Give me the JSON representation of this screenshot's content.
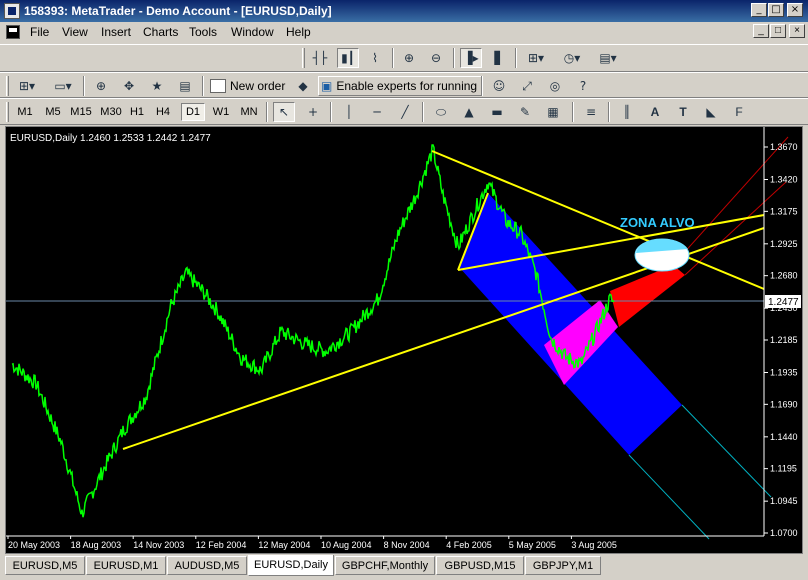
{
  "window": {
    "title": "158393: MetaTrader - Demo Account - [EURUSD,Daily]"
  },
  "window_buttons": {
    "minimize": "_",
    "maximize": "□",
    "close": "×"
  },
  "menu": [
    "File",
    "View",
    "Insert",
    "Charts",
    "Tools",
    "Window",
    "Help"
  ],
  "toolbar2": {
    "new_order": "New order",
    "experts": "Enable experts for running"
  },
  "timeframes": [
    "M1",
    "M5",
    "M15",
    "M30",
    "H1",
    "H4",
    "D1",
    "W1",
    "MN"
  ],
  "active_timeframe": "D1",
  "tools_text": {
    "text": "A",
    "label": "T",
    "fibo": "F"
  },
  "chart": {
    "info": "EURUSD,Daily  1.2460 1.2533 1.2442 1.2477",
    "current_price": "1.2477",
    "price_labels": [
      "1.3670",
      "1.3420",
      "1.3175",
      "1.2925",
      "1.2680",
      "1.2430",
      "1.2185",
      "1.1935",
      "1.1690",
      "1.1440",
      "1.1195",
      "1.0945",
      "1.0700"
    ],
    "date_labels": [
      "20 May 2003",
      "18 Aug 2003",
      "14 Nov 2003",
      "12 Feb 2004",
      "12 May 2004",
      "10 Aug 2004",
      "8 Nov 2004",
      "4 Feb 2005",
      "5 May 2005",
      "3 Aug 2005"
    ],
    "annotation": "ZONA ALVO",
    "colors": {
      "background": "#000000",
      "price_line": "#00ff00",
      "trendline": "#ffff00",
      "channel": "#0000ff",
      "channel_magenta": "#ff00ff",
      "target_channel": "#ff0000",
      "target_zone": "#66ddff",
      "annotation": "#33ccff"
    }
  },
  "chart_data": {
    "type": "line",
    "symbol": "EURUSD",
    "timeframe": "Daily",
    "x": [
      "20 May 2003",
      "18 Aug 2003",
      "14 Nov 2003",
      "12 Feb 2004",
      "12 May 2004",
      "10 Aug 2004",
      "8 Nov 2004",
      "4 Feb 2005",
      "5 May 2005",
      "3 Aug 2005"
    ],
    "series": [
      {
        "values": [
          1.18,
          1.08,
          1.17,
          1.29,
          1.2,
          1.22,
          1.3,
          1.33,
          1.23,
          1.2477
        ]
      }
    ],
    "ylim": [
      1.07,
      1.367
    ],
    "last": {
      "open": 1.246,
      "high": 1.2533,
      "low": 1.2442,
      "close": 1.2477
    },
    "annotations": [
      "ZONA ALVO"
    ]
  },
  "tabs": [
    "EURUSD,M5",
    "EURUSD,M1",
    "AUDUSD,M5",
    "EURUSD,Daily",
    "GBPCHF,Monthly",
    "GBPUSD,M15",
    "GBPJPY,M1"
  ],
  "active_tab": "EURUSD,Daily"
}
